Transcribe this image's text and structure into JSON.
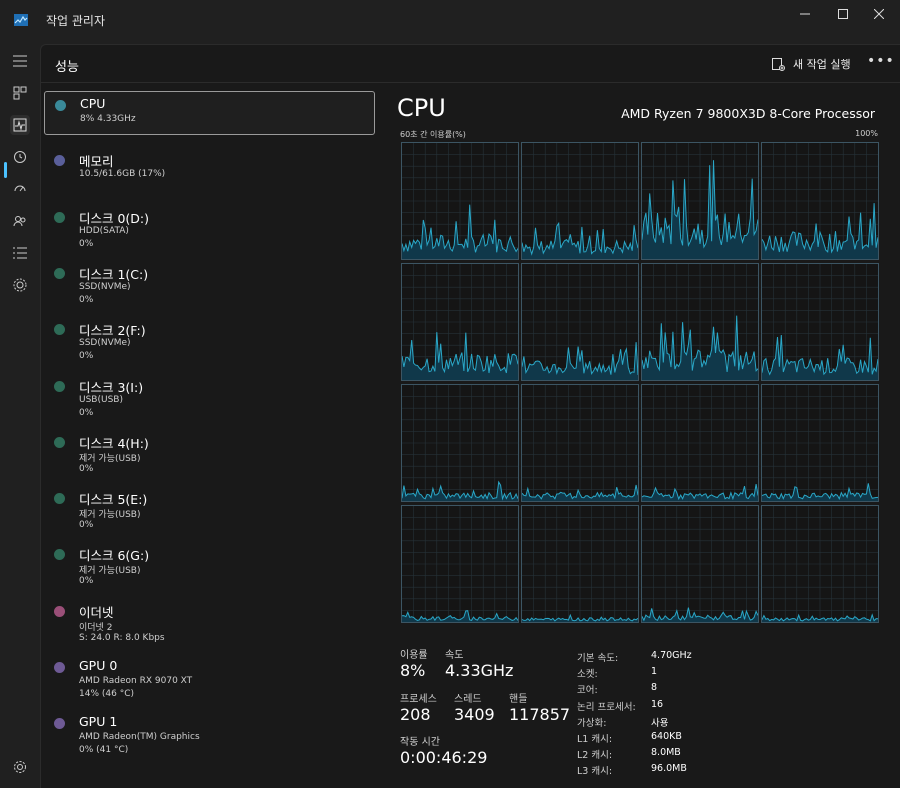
{
  "window": {
    "title": "작업 관리자"
  },
  "header": {
    "page_title": "성능",
    "run_task_label": "새 작업 실행",
    "more_label": "•••"
  },
  "rail": {
    "icons": [
      "menu-icon",
      "processes-icon",
      "performance-icon",
      "history-icon",
      "startup-icon",
      "users-icon",
      "details-icon",
      "services-icon",
      "settings-icon"
    ]
  },
  "colors": {
    "accent": "#4cc2ff",
    "graph_line": "#2aa7c7",
    "graph_fill": "#10384a",
    "grid": "#263239"
  },
  "list": {
    "items": [
      {
        "name": "CPU",
        "sub": "8%  4.33GHz",
        "sub2": "",
        "color": "#3a8a9a"
      },
      {
        "name": "메모리",
        "sub": "10.5/61.6GB (17%)",
        "sub2": "",
        "color": "#5a5f9a"
      },
      {
        "name": "디스크 0(D:)",
        "sub": "HDD(SATA)",
        "sub2": "0%",
        "color": "#2e6b57"
      },
      {
        "name": "디스크 1(C:)",
        "sub": "SSD(NVMe)",
        "sub2": "0%",
        "color": "#2e6b57"
      },
      {
        "name": "디스크 2(F:)",
        "sub": "SSD(NVMe)",
        "sub2": "0%",
        "color": "#2e6b57"
      },
      {
        "name": "디스크 3(I:)",
        "sub": "USB(USB)",
        "sub2": "0%",
        "color": "#2e6b57"
      },
      {
        "name": "디스크 4(H:)",
        "sub": "제거 가능(USB)",
        "sub2": "0%",
        "color": "#2e6b57"
      },
      {
        "name": "디스크 5(E:)",
        "sub": "제거 가능(USB)",
        "sub2": "0%",
        "color": "#2e6b57"
      },
      {
        "name": "디스크 6(G:)",
        "sub": "제거 가능(USB)",
        "sub2": "0%",
        "color": "#2e6b57"
      },
      {
        "name": "이더넷",
        "sub": "이더넷 2",
        "sub2": "S: 24.0  R: 8.0 Kbps",
        "color": "#9a4f78"
      },
      {
        "name": "GPU 0",
        "sub": "AMD Radeon RX 9070 XT",
        "sub2": "14% (46 °C)",
        "color": "#6e5a95"
      },
      {
        "name": "GPU 1",
        "sub": "AMD Radeon(TM) Graphics",
        "sub2": "0% (41 °C)",
        "color": "#6e5a95"
      }
    ]
  },
  "detail": {
    "title": "CPU",
    "processor": "AMD Ryzen 7 9800X3D 8-Core Processor",
    "axis_left": "60초 간 이용률(%)",
    "axis_right": "100%",
    "graph_levels": [
      0.18,
      0.14,
      0.34,
      0.2,
      0.2,
      0.14,
      0.22,
      0.16,
      0.06,
      0.06,
      0.06,
      0.06,
      0.04,
      0.03,
      0.05,
      0.03
    ],
    "stats": {
      "util_label": "이용률",
      "util_value": "8%",
      "speed_label": "속도",
      "speed_value": "4.33GHz",
      "proc_label": "프로세스",
      "proc_value": "208",
      "thread_label": "스레드",
      "thread_value": "3409",
      "handle_label": "핸들",
      "handle_value": "117857",
      "uptime_label": "작동 시간",
      "uptime_value": "0:00:46:29"
    },
    "specs": [
      {
        "label": "기본 속도:",
        "value": "4.70GHz"
      },
      {
        "label": "소켓:",
        "value": "1"
      },
      {
        "label": "코어:",
        "value": "8"
      },
      {
        "label": "논리 프로세서:",
        "value": "16"
      },
      {
        "label": "가상화:",
        "value": "사용"
      },
      {
        "label": "L1 캐시:",
        "value": "640KB"
      },
      {
        "label": "L2 캐시:",
        "value": "8.0MB"
      },
      {
        "label": "L3 캐시:",
        "value": "96.0MB"
      }
    ]
  }
}
